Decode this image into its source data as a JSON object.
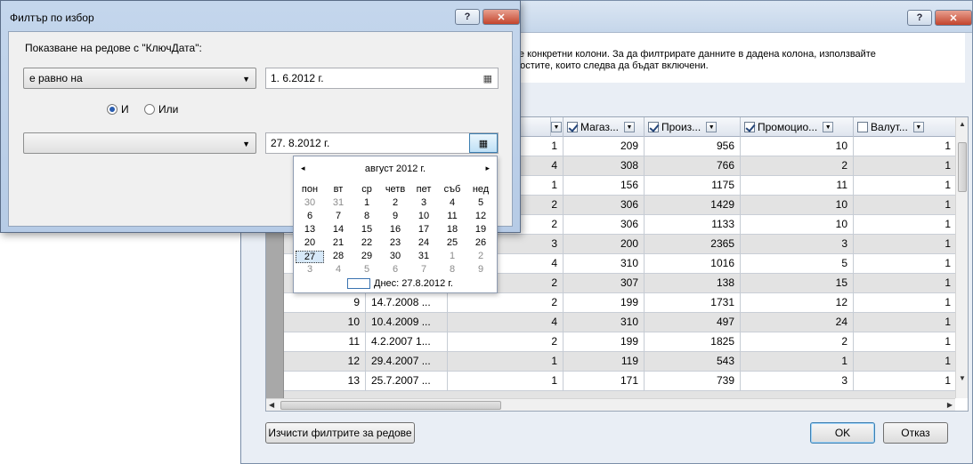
{
  "main_dialog": {
    "banner_text": "те конкретни колони. За да филтрирате данните в дадена колона, използвайте\nноститe, които следва да бъдат включени.",
    "columns": [
      {
        "label": "",
        "checked": false
      },
      {
        "label": "Магаз...",
        "checked": true
      },
      {
        "label": "Произ...",
        "checked": true
      },
      {
        "label": "Промоцио...",
        "checked": true
      },
      {
        "label": "Валут...",
        "checked": false
      }
    ],
    "rows": [
      {
        "num": "",
        "date": "",
        "c1": "1",
        "c2": "209",
        "c3": "956",
        "c4": "10",
        "c5": "1"
      },
      {
        "num": "",
        "date": "",
        "c1": "4",
        "c2": "308",
        "c3": "766",
        "c4": "2",
        "c5": "1"
      },
      {
        "num": "",
        "date": "",
        "c1": "1",
        "c2": "156",
        "c3": "1175",
        "c4": "11",
        "c5": "1"
      },
      {
        "num": "",
        "date": "",
        "c1": "2",
        "c2": "306",
        "c3": "1429",
        "c4": "10",
        "c5": "1"
      },
      {
        "num": "",
        "date": "",
        "c1": "2",
        "c2": "306",
        "c3": "1133",
        "c4": "10",
        "c5": "1"
      },
      {
        "num": "",
        "date": "",
        "c1": "3",
        "c2": "200",
        "c3": "2365",
        "c4": "3",
        "c5": "1"
      },
      {
        "num": "",
        "date": "",
        "c1": "4",
        "c2": "310",
        "c3": "1016",
        "c4": "5",
        "c5": "1"
      },
      {
        "num": "",
        "date": "",
        "c1": "2",
        "c2": "307",
        "c3": "138",
        "c4": "15",
        "c5": "1"
      },
      {
        "num": "9",
        "date": "14.7.2008 ...",
        "c1": "2",
        "c2": "199",
        "c3": "1731",
        "c4": "12",
        "c5": "1"
      },
      {
        "num": "10",
        "date": "10.4.2009 ...",
        "c1": "4",
        "c2": "310",
        "c3": "497",
        "c4": "24",
        "c5": "1"
      },
      {
        "num": "11",
        "date": "4.2.2007 1...",
        "c1": "2",
        "c2": "199",
        "c3": "1825",
        "c4": "2",
        "c5": "1"
      },
      {
        "num": "12",
        "date": "29.4.2007 ...",
        "c1": "1",
        "c2": "119",
        "c3": "543",
        "c4": "1",
        "c5": "1"
      },
      {
        "num": "13",
        "date": "25.7.2007 ...",
        "c1": "1",
        "c2": "171",
        "c3": "739",
        "c4": "3",
        "c5": "1"
      }
    ],
    "clear_filters_label": "Изчисти филтрите за редове",
    "ok_label": "OK",
    "cancel_label": "Отказ"
  },
  "filter_dialog": {
    "title": "Филтър по избор",
    "prompt": "Показване на редове с \"КлючДата\":",
    "operator1": "е равно на",
    "value1": "1.  6.2012 г.",
    "radio_and": "И",
    "radio_or": "Или",
    "operator2": "",
    "value2": "27.  8.2012 г."
  },
  "calendar": {
    "month_label": "август 2012 г.",
    "weekdays": [
      "пон",
      "вт",
      "ср",
      "четв",
      "пет",
      "съб",
      "нед"
    ],
    "weeks": [
      [
        "30",
        "31",
        "1",
        "2",
        "3",
        "4",
        "5"
      ],
      [
        "6",
        "7",
        "8",
        "9",
        "10",
        "11",
        "12"
      ],
      [
        "13",
        "14",
        "15",
        "16",
        "17",
        "18",
        "19"
      ],
      [
        "20",
        "21",
        "22",
        "23",
        "24",
        "25",
        "26"
      ],
      [
        "27",
        "28",
        "29",
        "30",
        "31",
        "1",
        "2"
      ],
      [
        "3",
        "4",
        "5",
        "6",
        "7",
        "8",
        "9"
      ]
    ],
    "today_label": "Днес: 27.8.2012 г."
  },
  "icons": {
    "help": "?",
    "close": "✕",
    "calendar": "▦",
    "dropdown": "▼",
    "prev": "◂",
    "next": "▸"
  }
}
